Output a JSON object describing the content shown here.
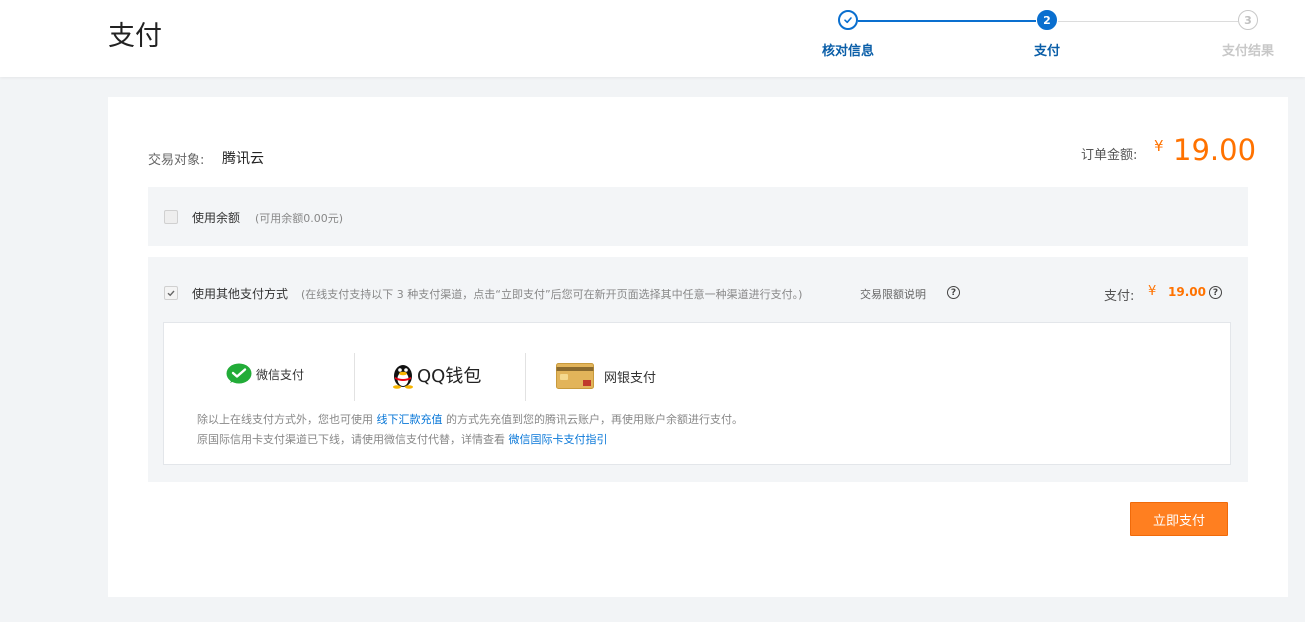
{
  "header": {
    "title": "支付"
  },
  "steps": [
    {
      "num": "✓",
      "label": "核对信息",
      "state": "done"
    },
    {
      "num": "2",
      "label": "支付",
      "state": "active"
    },
    {
      "num": "3",
      "label": "支付结果",
      "state": "pending"
    }
  ],
  "colors": {
    "accent": "#0a6fcf",
    "orange": "#ff7200",
    "muted": "#c8c8c8"
  },
  "order": {
    "target_label": "交易对象:",
    "target_value": "腾讯云",
    "amount_label": "订单金额:",
    "currency": "¥",
    "amount": "19.00"
  },
  "balance": {
    "checked": false,
    "label": "使用余额",
    "note": "(可用余额0.00元)"
  },
  "other": {
    "checked": true,
    "label": "使用其他支付方式",
    "note": "(在线支付支持以下 3 种支付渠道，点击“立即支付”后您可在新开页面选择其中任意一种渠道进行支付。)",
    "limit_link": "交易限额说明",
    "pay_label": "支付:",
    "currency": "¥",
    "pay_amount": "19.00"
  },
  "methods": [
    {
      "icon": "wechat-icon",
      "label": "微信支付"
    },
    {
      "icon": "qq-penguin-icon",
      "label": "QQ钱包"
    },
    {
      "icon": "bank-card-icon",
      "label": "网银支付"
    }
  ],
  "info": {
    "line1_pre": "除以上在线支付方式外，您也可使用",
    "line1_link": "线下汇款充值",
    "line1_post": "的方式先充值到您的腾讯云账户，再使用账户余额进行支付。",
    "line2_pre": "原国际信用卡支付渠道已下线，请使用微信支付代替，详情查看",
    "line2_link": "微信国际卡支付指引"
  },
  "actions": {
    "pay_now": "立即支付"
  }
}
